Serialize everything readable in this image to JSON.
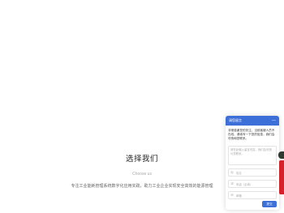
{
  "section": {
    "title": "选择我们",
    "subtitle": "Choose us",
    "description": "专注工业能耗管理系统数字化应用实践，助力工业企业实现安全高效的能源管理"
  },
  "chat": {
    "header_title": "请您留言",
    "minimize": "—",
    "message": "非常感谢您的关注，当前客服人员不在线，请填写一下您的信息，我们会尽快和您联系。",
    "textarea_placeholder": "请在此输入留言内容，我们会尽快与您联系。",
    "fields": [
      {
        "icon": "user-icon",
        "glyph": "☺",
        "placeholder": "姓名"
      },
      {
        "icon": "phone-icon",
        "glyph": "☏",
        "placeholder": "电话（必填）"
      },
      {
        "icon": "mail-icon",
        "glyph": "✉",
        "placeholder": "邮箱"
      }
    ],
    "submit_label": "提交",
    "accent_color": "#3d6fd9"
  },
  "side": {
    "tab_color": "#d6202a",
    "dot_color": "#2e3a32"
  }
}
